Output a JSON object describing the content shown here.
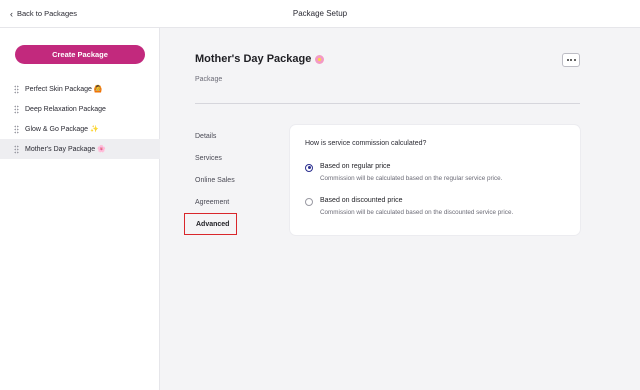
{
  "topbar": {
    "back_label": "Back to Packages",
    "title": "Package Setup"
  },
  "sidebar": {
    "create_label": "Create Package",
    "items": [
      {
        "label": "Perfect Skin Package",
        "emoji": "🙆",
        "active": false
      },
      {
        "label": "Deep Relaxation Package",
        "emoji": "",
        "active": false
      },
      {
        "label": "Glow & Go Package",
        "emoji": "✨",
        "active": false
      },
      {
        "label": "Mother's Day Package",
        "emoji": "🌸",
        "active": true
      }
    ]
  },
  "main": {
    "title": "Mother's Day Package",
    "subtitle": "Package",
    "tabs": [
      {
        "label": "Details",
        "active": false
      },
      {
        "label": "Services",
        "active": false
      },
      {
        "label": "Online Sales",
        "active": false
      },
      {
        "label": "Agreement",
        "active": false
      },
      {
        "label": "Advanced",
        "active": true
      }
    ],
    "commission": {
      "question": "How is service commission calculated?",
      "options": [
        {
          "label": "Based on regular price",
          "description": "Commission will be calculated based on the regular service price.",
          "selected": true
        },
        {
          "label": "Based on discounted price",
          "description": "Commission will be calculated based on the discounted service price.",
          "selected": false
        }
      ]
    }
  },
  "colors": {
    "brand": "#c2297d",
    "radio_selected": "#2b2f8f",
    "highlight_border": "#d9262b"
  },
  "icons": {
    "back": "chevron-left-icon",
    "more": "ellipsis-icon",
    "drag": "drag-handle-icon"
  }
}
